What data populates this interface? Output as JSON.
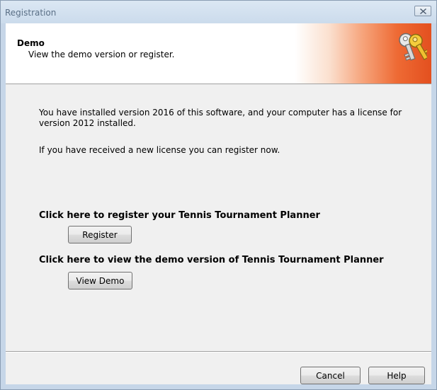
{
  "window": {
    "title": "Registration",
    "close_icon": "close-icon"
  },
  "header": {
    "title": "Demo",
    "subtitle": "View the demo version or register.",
    "icon": "keys-icon"
  },
  "body": {
    "message_1": "You have installed version 2016 of this software, and your computer has a license for version 2012 installed.",
    "message_2": "If you have received a new license you can register now.",
    "register_heading": "Click here to register your Tennis Tournament Planner",
    "register_button": "Register",
    "demo_heading": "Click here to view the demo version of Tennis Tournament Planner",
    "demo_button": "View Demo"
  },
  "footer": {
    "cancel_button": "Cancel",
    "help_button": "Help"
  },
  "colors": {
    "header_accent": "#e3501f",
    "window_frame": "#c6d6e8",
    "client_background": "#f0f0f0"
  }
}
